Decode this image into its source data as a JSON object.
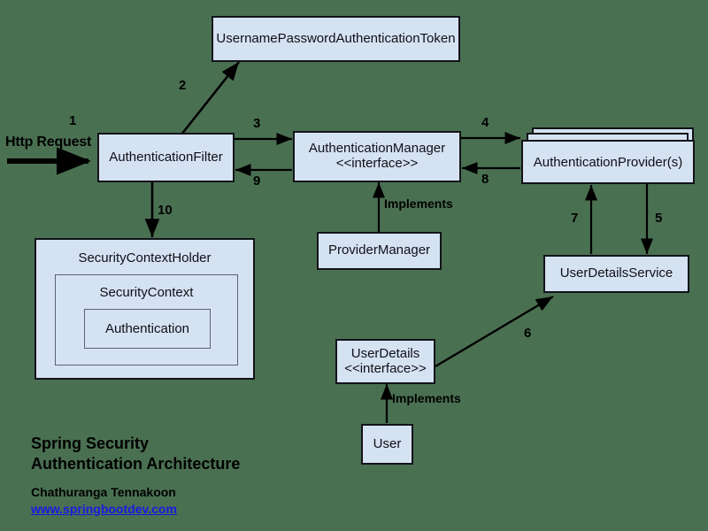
{
  "diagram": {
    "title": "Spring Security Authentication Architecture",
    "background_color": "#4a7052",
    "node_fill_color": "#d5e2f2",
    "node_border_color": "#12131a",
    "link_color": "#1a1ae0"
  },
  "nodes": {
    "token": {
      "label": "UsernamePasswordAuthenticationToken"
    },
    "filter": {
      "label": "AuthenticationFilter"
    },
    "manager": {
      "line1": "AuthenticationManager",
      "line2": "<<interface>>"
    },
    "provider": {
      "label": "AuthenticationProvider(s)"
    },
    "provider_manager": {
      "label": "ProviderManager"
    },
    "user_details_service": {
      "label": "UserDetailsService"
    },
    "user_details": {
      "line1": "UserDetails",
      "line2": "<<interface>>"
    },
    "user": {
      "label": "User"
    },
    "security_context_holder": {
      "label": "SecurityContextHolder"
    },
    "security_context": {
      "label": "SecurityContext"
    },
    "authentication": {
      "label": "Authentication"
    }
  },
  "edges": {
    "http_request": "Http Request",
    "n1": "1",
    "n2": "2",
    "n3": "3",
    "n4": "4",
    "n5": "5",
    "n6": "6",
    "n7": "7",
    "n8": "8",
    "n9": "9",
    "n10": "10",
    "implements_manager": "Implements",
    "implements_user": "Implements"
  },
  "caption": {
    "title_line1": "Spring Security",
    "title_line2": "Authentication Architecture",
    "author": "Chathuranga Tennakoon",
    "website": "www.springbootdev.com"
  }
}
